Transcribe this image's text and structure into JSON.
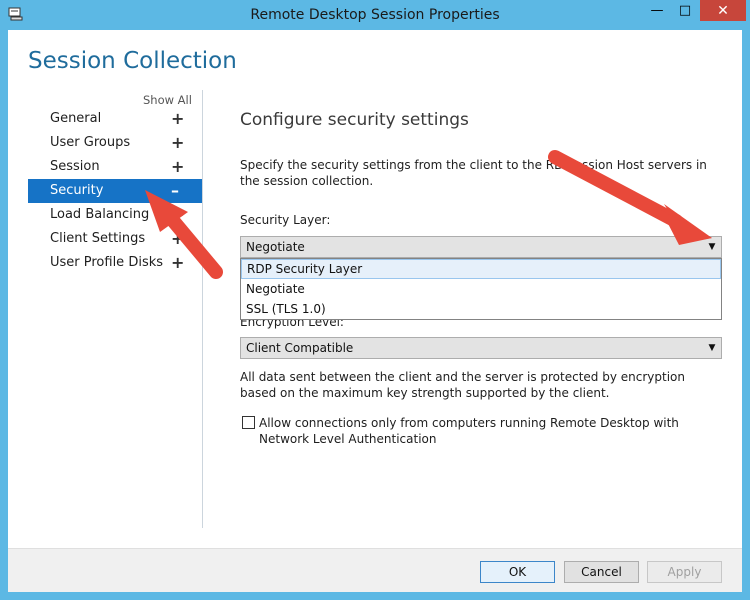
{
  "window": {
    "title": "Remote Desktop Session Properties",
    "minimize": "—",
    "maximize": "□",
    "close": "✕"
  },
  "heading": "Session Collection",
  "nav": {
    "show_all": "Show All",
    "items": [
      {
        "label": "General",
        "sign": "+"
      },
      {
        "label": "User Groups",
        "sign": "+"
      },
      {
        "label": "Session",
        "sign": "+"
      },
      {
        "label": "Security",
        "sign": "–",
        "selected": true
      },
      {
        "label": "Load Balancing",
        "sign": "+"
      },
      {
        "label": "Client Settings",
        "sign": "+"
      },
      {
        "label": "User Profile Disks",
        "sign": "+"
      }
    ]
  },
  "main": {
    "title": "Configure security settings",
    "description": "Specify the security settings from the client to the RD Session Host servers in the session collection.",
    "security_layer": {
      "label": "Security Layer:",
      "value": "Negotiate",
      "options": [
        "RDP Security Layer",
        "Negotiate",
        "SSL (TLS 1.0)"
      ],
      "highlighted": "RDP Security Layer"
    },
    "encryption_level": {
      "label": "Encryption Level:",
      "value": "Client Compatible"
    },
    "encryption_note": "All data sent between the client and the server is protected by encryption based on the maximum key strength supported by the client.",
    "nla_checkbox": {
      "label": "Allow connections only from computers running Remote Desktop with Network Level Authentication",
      "checked": false
    }
  },
  "footer": {
    "ok": "OK",
    "cancel": "Cancel",
    "apply": "Apply"
  },
  "colors": {
    "accent": "#1673c6",
    "heading": "#1f6c9c",
    "annotation_arrow": "#e8493a"
  }
}
